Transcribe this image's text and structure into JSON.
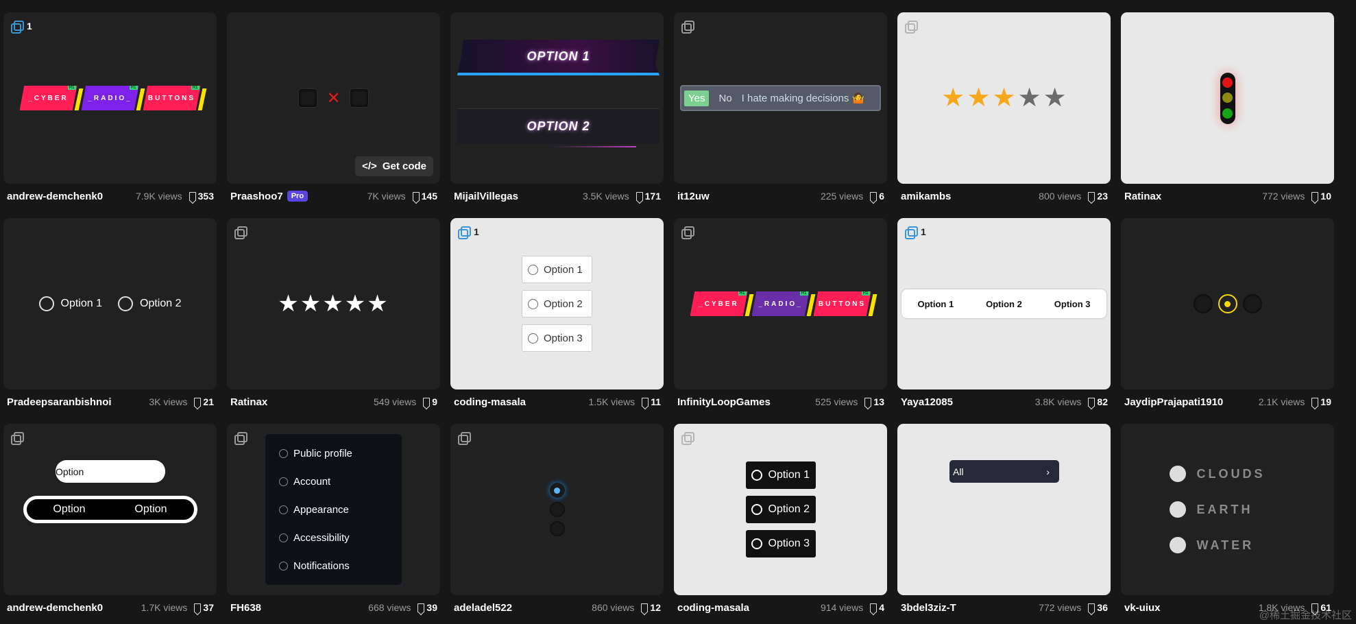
{
  "cards": [
    {
      "author": "andrew-demchenk0",
      "views": "7.9K views",
      "saves": "353",
      "count": "1",
      "cyber": [
        "_CYBER",
        "_RADIO_",
        "BUTTONS"
      ],
      "cyber_tag": "R1"
    },
    {
      "author": "Praashoo7",
      "pro": "Pro",
      "views": "7K views",
      "saves": "145",
      "get_code": "Get code"
    },
    {
      "author": "MijailVillegas",
      "views": "3.5K views",
      "saves": "171",
      "opt1": "OPTION 1",
      "opt2": "OPTION 2"
    },
    {
      "author": "it12uw",
      "views": "225 views",
      "saves": "6",
      "yes": "Yes",
      "no": "No",
      "hate": "I hate making decisions 🤷"
    },
    {
      "author": "amikambs",
      "views": "800 views",
      "saves": "23"
    },
    {
      "author": "Ratinax",
      "views": "772 views",
      "saves": "10"
    },
    {
      "author": "Pradeepsaranbishnoi",
      "views": "3K views",
      "saves": "21",
      "options": [
        "Option 1",
        "Option 2"
      ]
    },
    {
      "author": "Ratinax",
      "views": "549 views",
      "saves": "9",
      "stars": "★★★★★"
    },
    {
      "author": "coding-masala",
      "views": "1.5K views",
      "saves": "11",
      "count": "1",
      "options": [
        "Option 1",
        "Option 2",
        "Option 3"
      ]
    },
    {
      "author": "InfinityLoopGames",
      "views": "525 views",
      "saves": "13",
      "cyber": [
        "_CYBER",
        "_RADIO_",
        "BUTTONS"
      ],
      "cyber_tag": "R1"
    },
    {
      "author": "Yaya12085",
      "views": "3.8K views",
      "saves": "82",
      "count": "1",
      "options": [
        "Option 1",
        "Option 2",
        "Option 3"
      ]
    },
    {
      "author": "JaydipPrajapati1910",
      "views": "2.1K views",
      "saves": "19"
    },
    {
      "author": "andrew-demchenk0",
      "views": "1.7K views",
      "saves": "37",
      "options": [
        "Option",
        "Option",
        "Option"
      ]
    },
    {
      "author": "FH638",
      "views": "668 views",
      "saves": "39",
      "menu": [
        "Public profile",
        "Account",
        "Appearance",
        "Accessibility",
        "Notifications"
      ]
    },
    {
      "author": "adeladel522",
      "views": "860 views",
      "saves": "12"
    },
    {
      "author": "coding-masala",
      "views": "914 views",
      "saves": "4",
      "options": [
        "Option 1",
        "Option 2",
        "Option 3"
      ]
    },
    {
      "author": "3bdel3ziz-T",
      "views": "772 views",
      "saves": "36",
      "select": "All",
      "select_chevron": "›"
    },
    {
      "author": "vk-uiux",
      "views": "1.8K views",
      "saves": "61",
      "elements": [
        "CLOUDS",
        "EARTH",
        "WATER"
      ]
    }
  ],
  "watermark": "@稀土掘金技术社区",
  "colors": {
    "star_gold": "#f7a71b",
    "star_gray": "#6b6b6b",
    "pro_badge": "#5b45e0",
    "accent_blue": "#3a97d4"
  },
  "icons": {
    "copy": "copy-icon",
    "bookmark": "bookmark-icon",
    "code": "code-icon",
    "close": "close-icon"
  }
}
